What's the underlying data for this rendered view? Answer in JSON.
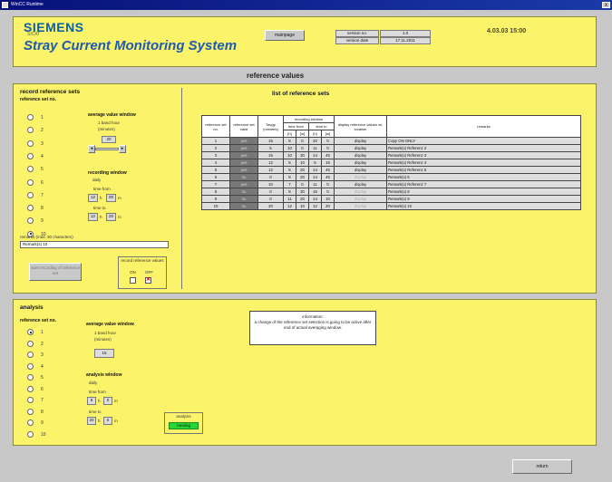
{
  "window": {
    "title": "WinCC Runtime",
    "close_label": "X"
  },
  "header": {
    "brand": "SIEMENS",
    "brand_sub": "SICAT",
    "title": "Stray Current Monitoring System",
    "mainpage_label": "mainpage",
    "version_label": "version no.",
    "version_value": "1.0",
    "date_label": "version date",
    "date_value": "17.11.2011",
    "clock": "4.03.03 15:00"
  },
  "section_title": "reference values",
  "record": {
    "title": "record reference sets",
    "set_label": "reference set no.",
    "radios": [
      "1",
      "2",
      "3",
      "4",
      "5",
      "6",
      "7",
      "8",
      "9",
      "10"
    ],
    "selected_index": 9,
    "avg_title": "average value window",
    "avg_sub1": "1 band hour",
    "avg_sub2": "(minutes)",
    "avg_value": "20",
    "rec_title": "recording window",
    "rec_daily": "daily",
    "rec_from": "time from",
    "rec_from_h": "12",
    "rec_from_m": "00",
    "rec_to": "time to",
    "rec_to_h": "12",
    "rec_to_m": "20",
    "h_unit": "h",
    "m_unit": "m",
    "remarks_label": "remarks (max. 30 characters)",
    "remarks_value": "Remark(s) 10",
    "start_button": "start recording of reference set",
    "rec_values_label": "record reference values",
    "on_label": "ON",
    "off_label": "OFF"
  },
  "list": {
    "title": "list of reference sets",
    "headers": {
      "ref": "reference set no.",
      "valid": "reference set valid",
      "tavg": "Tavgp (minutes)",
      "window": "recording window",
      "from": "time from",
      "to": "time to",
      "h": "[h]",
      "m": "[m]",
      "display": "display reference values vs. location",
      "remarks": "remarks"
    },
    "rows": [
      {
        "no": "1",
        "valid": "yes",
        "tavg": "15",
        "fh": "8",
        "fm": "0",
        "th": "20",
        "tm": "0",
        "disp": "display",
        "rem": "Copy ON ONLY"
      },
      {
        "no": "2",
        "valid": "yes",
        "tavg": "5",
        "fh": "10",
        "fm": "0",
        "th": "11",
        "tm": "0",
        "disp": "display",
        "rem": "Remark(s) Referenz 2"
      },
      {
        "no": "3",
        "valid": "yes",
        "tavg": "15",
        "fh": "10",
        "fm": "30",
        "th": "14",
        "tm": "45",
        "disp": "display",
        "rem": "Remark(s) Referenz 3"
      },
      {
        "no": "4",
        "valid": "yes",
        "tavg": "12",
        "fh": "5",
        "fm": "10",
        "th": "6",
        "tm": "15",
        "disp": "display",
        "rem": "Remark(s) Referenz 4"
      },
      {
        "no": "5",
        "valid": "yes",
        "tavg": "12",
        "fh": "5",
        "fm": "20",
        "th": "14",
        "tm": "45",
        "disp": "display",
        "rem": "Remark(s) Referenz 5"
      },
      {
        "no": "6",
        "valid": "no",
        "tavg": "0",
        "fh": "8",
        "fm": "20",
        "th": "14",
        "tm": "45",
        "disp": "display",
        "rem": "Remark(s) 6"
      },
      {
        "no": "7",
        "valid": "yes",
        "tavg": "10",
        "fh": "7",
        "fm": "0",
        "th": "11",
        "tm": "0",
        "disp": "display",
        "rem": "Remark(s) Referenz 7"
      },
      {
        "no": "8",
        "valid": "no",
        "tavg": "0",
        "fh": "8",
        "fm": "30",
        "th": "15",
        "tm": "0",
        "disp": "display",
        "rem": "Remark(s) 8"
      },
      {
        "no": "9",
        "valid": "no",
        "tavg": "0",
        "fh": "11",
        "fm": "20",
        "th": "14",
        "tm": "10",
        "disp": "display",
        "rem": "Remark(s) 9"
      },
      {
        "no": "10",
        "valid": "no",
        "tavg": "20",
        "fh": "12",
        "fm": "10",
        "th": "12",
        "tm": "20",
        "disp": "display",
        "rem": "Remark(s) 10"
      }
    ]
  },
  "analysis": {
    "title": "analysis",
    "set_label": "reference set no.",
    "radios": [
      "1",
      "2",
      "3",
      "4",
      "5",
      "6",
      "7",
      "8",
      "9",
      "10"
    ],
    "selected_index": 0,
    "avg_title": "average value window",
    "avg_sub1": "1 band hour",
    "avg_sub2": "(minutes)",
    "avg_value": "15",
    "win_title": "analysis window",
    "win_daily": "daily",
    "win_from": "time from",
    "win_from_h": "8",
    "win_from_m": "0",
    "win_to": "time to",
    "win_to_h": "20",
    "win_to_m": "0",
    "h_unit": "h",
    "m_unit": "m",
    "status_label": "analysis",
    "status_value": "running",
    "info_title": "information:",
    "info_text": "a change of the reference set selection is going to be active after end of actual averaging window."
  },
  "footer": {
    "return_label": "return"
  }
}
